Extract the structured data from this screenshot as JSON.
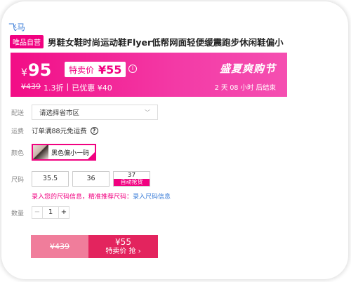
{
  "breadcrumb_brand": "飞马",
  "title": {
    "badge": "唯品自营",
    "text": "男鞋女鞋时尚运动鞋Flyer低帮网面轻便缓震跑步休闲鞋偏小"
  },
  "price": {
    "symbol": "¥",
    "main": "95",
    "sale_label": "特卖价",
    "sale_price": "¥55",
    "info_icon": "info-icon",
    "original": "¥439",
    "discount": "1.3折",
    "saved": "已优惠 ¥40",
    "promo_title": "盛夏爽购节",
    "countdown": "2 天 08 小时 后结束",
    "color_primary": "#f10180"
  },
  "options": {
    "region_label": "配送",
    "region_value": "请选择省市区",
    "freight_label": "运费",
    "freight_text": "订单满88元免运费",
    "color_label": "颜色",
    "color_value": "黑色偏小一码",
    "size_label": "尺码",
    "sizes": [
      "35.5",
      "36",
      "37"
    ],
    "size_auto_tag": "自动抢货",
    "size_info": "录入您的尺码信息，精准推荐尺码：",
    "size_info_link": "录入尺码信息",
    "qty_label": "数量",
    "qty_minus": "−",
    "qty_value": "1",
    "qty_plus": "+"
  },
  "buy": {
    "orig_price": "¥439",
    "price": "¥55",
    "label": "特卖价 抢 ›"
  }
}
